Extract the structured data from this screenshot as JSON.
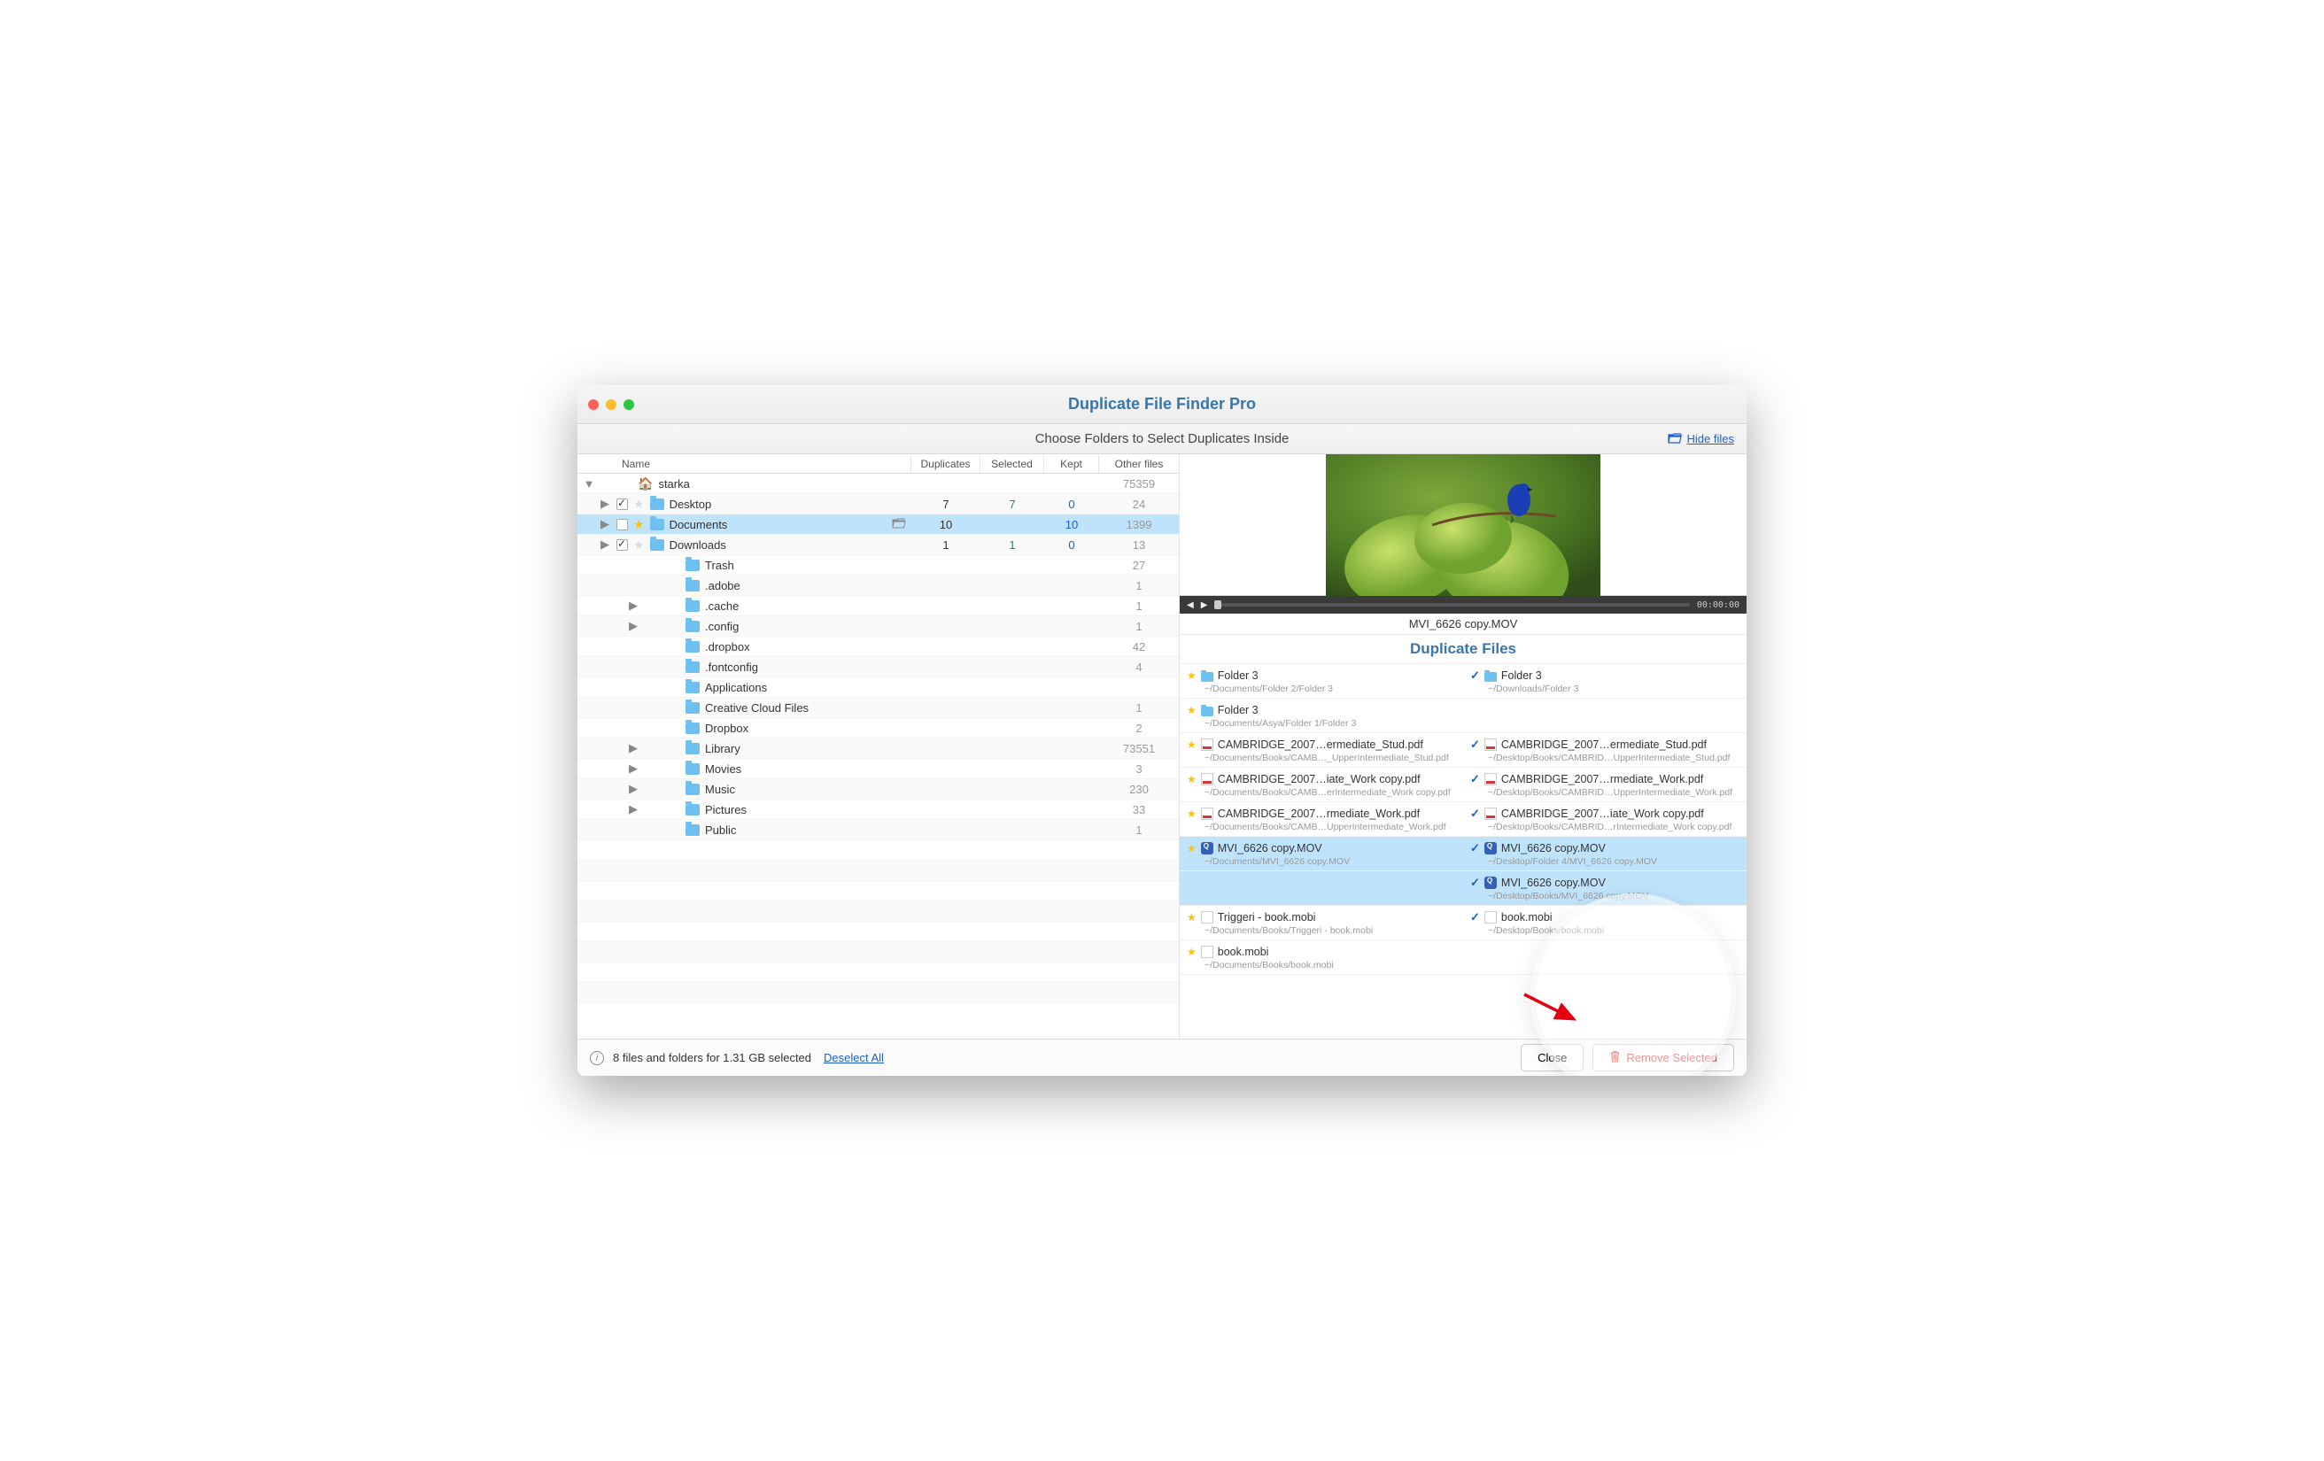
{
  "window": {
    "title": "Duplicate File Finder Pro"
  },
  "subbar": {
    "text": "Choose Folders to Select Duplicates Inside",
    "hide_files": "Hide files"
  },
  "columns": {
    "name": "Name",
    "duplicates": "Duplicates",
    "selected": "Selected",
    "kept": "Kept",
    "other": "Other files"
  },
  "tree": {
    "root": {
      "name": "starka",
      "other": "75359"
    },
    "rows": [
      {
        "name": "Desktop",
        "indent": 1,
        "disc": true,
        "checked": true,
        "star": false,
        "dup": "7",
        "sel": "7",
        "kept": "0",
        "other": "24"
      },
      {
        "name": "Documents",
        "indent": 1,
        "disc": true,
        "checked": false,
        "star": true,
        "dup": "10",
        "sel": "",
        "kept": "10",
        "other": "1399",
        "selected": true,
        "open": true
      },
      {
        "name": "Downloads",
        "indent": 1,
        "disc": true,
        "checked": true,
        "star": false,
        "dup": "1",
        "sel": "1",
        "kept": "0",
        "other": "13"
      },
      {
        "name": "Trash",
        "indent": 2,
        "other": "27"
      },
      {
        "name": ".adobe",
        "indent": 2,
        "other": "1"
      },
      {
        "name": ".cache",
        "indent": 2,
        "disc": true,
        "other": "1"
      },
      {
        "name": ".config",
        "indent": 2,
        "disc": true,
        "other": "1"
      },
      {
        "name": ".dropbox",
        "indent": 2,
        "other": "42"
      },
      {
        "name": ".fontconfig",
        "indent": 2,
        "other": "4"
      },
      {
        "name": "Applications",
        "indent": 2,
        "other": ""
      },
      {
        "name": "Creative Cloud Files",
        "indent": 2,
        "other": "1"
      },
      {
        "name": "Dropbox",
        "indent": 2,
        "other": "2"
      },
      {
        "name": "Library",
        "indent": 2,
        "disc": true,
        "other": "73551"
      },
      {
        "name": "Movies",
        "indent": 2,
        "disc": true,
        "other": "3"
      },
      {
        "name": "Music",
        "indent": 2,
        "disc": true,
        "other": "230"
      },
      {
        "name": "Pictures",
        "indent": 2,
        "disc": true,
        "other": "33"
      },
      {
        "name": "Public",
        "indent": 2,
        "other": "1"
      }
    ]
  },
  "preview": {
    "filename": "MVI_6626 copy.MOV",
    "time": "00:00:00"
  },
  "dup_title": "Duplicate Files",
  "dup_pairs": [
    {
      "left": {
        "mark": "star",
        "icon": "folder",
        "name": "Folder 3",
        "path": "~/Documents/Folder 2/Folder 3"
      },
      "right": {
        "mark": "check",
        "icon": "folder",
        "name": "Folder 3",
        "path": "~/Downloads/Folder 3"
      }
    },
    {
      "left": {
        "mark": "star",
        "icon": "folder",
        "name": "Folder 3",
        "path": "~/Documents/Asya/Folder 1/Folder 3"
      },
      "right": null
    },
    {
      "left": {
        "mark": "star",
        "icon": "pdf",
        "name": "CAMBRIDGE_2007…ermediate_Stud.pdf",
        "path": "~/Documents/Books/CAMB…_UpperIntermediate_Stud.pdf"
      },
      "right": {
        "mark": "check",
        "icon": "pdf",
        "name": "CAMBRIDGE_2007…ermediate_Stud.pdf",
        "path": "~/Desktop/Books/CAMBRID…UpperIntermediate_Stud.pdf"
      }
    },
    {
      "left": {
        "mark": "star",
        "icon": "pdf",
        "name": "CAMBRIDGE_2007…iate_Work copy.pdf",
        "path": "~/Documents/Books/CAMB…erIntermediate_Work copy.pdf"
      },
      "right": {
        "mark": "check",
        "icon": "pdf",
        "name": "CAMBRIDGE_2007…rmediate_Work.pdf",
        "path": "~/Desktop/Books/CAMBRID…UpperIntermediate_Work.pdf"
      }
    },
    {
      "left": {
        "mark": "star",
        "icon": "pdf",
        "name": "CAMBRIDGE_2007…rmediate_Work.pdf",
        "path": "~/Documents/Books/CAMB…UpperIntermediate_Work.pdf"
      },
      "right": {
        "mark": "check",
        "icon": "pdf",
        "name": "CAMBRIDGE_2007…iate_Work copy.pdf",
        "path": "~/Desktop/Books/CAMBRID…rIntermediate_Work copy.pdf"
      }
    },
    {
      "selected": true,
      "left": {
        "mark": "star",
        "icon": "mov",
        "name": "MVI_6626 copy.MOV",
        "path": "~/Documents/MVI_6626 copy.MOV"
      },
      "right": {
        "mark": "check",
        "icon": "mov",
        "name": "MVI_6626 copy.MOV",
        "path": "~/Desktop/Folder 4/MVI_6626 copy.MOV"
      }
    },
    {
      "selected": true,
      "left": null,
      "right": {
        "mark": "check",
        "icon": "mov",
        "name": "MVI_6626 copy.MOV",
        "path": "~/Desktop/Books/MVI_6626 copy.MOV"
      }
    },
    {
      "left": {
        "mark": "star",
        "icon": "doc",
        "name": "Triggeri - book.mobi",
        "path": "~/Documents/Books/Triggeri - book.mobi"
      },
      "right": {
        "mark": "check",
        "icon": "doc",
        "name": "book.mobi",
        "path": "~/Desktop/Books/book.mobi"
      }
    },
    {
      "left": {
        "mark": "star",
        "icon": "doc",
        "name": "book.mobi",
        "path": "~/Documents/Books/book.mobi"
      },
      "right": null
    }
  ],
  "footer": {
    "status": "8 files and folders for 1.31 GB selected",
    "deselect": "Deselect All",
    "close": "Close",
    "remove": "Remove Selected"
  }
}
